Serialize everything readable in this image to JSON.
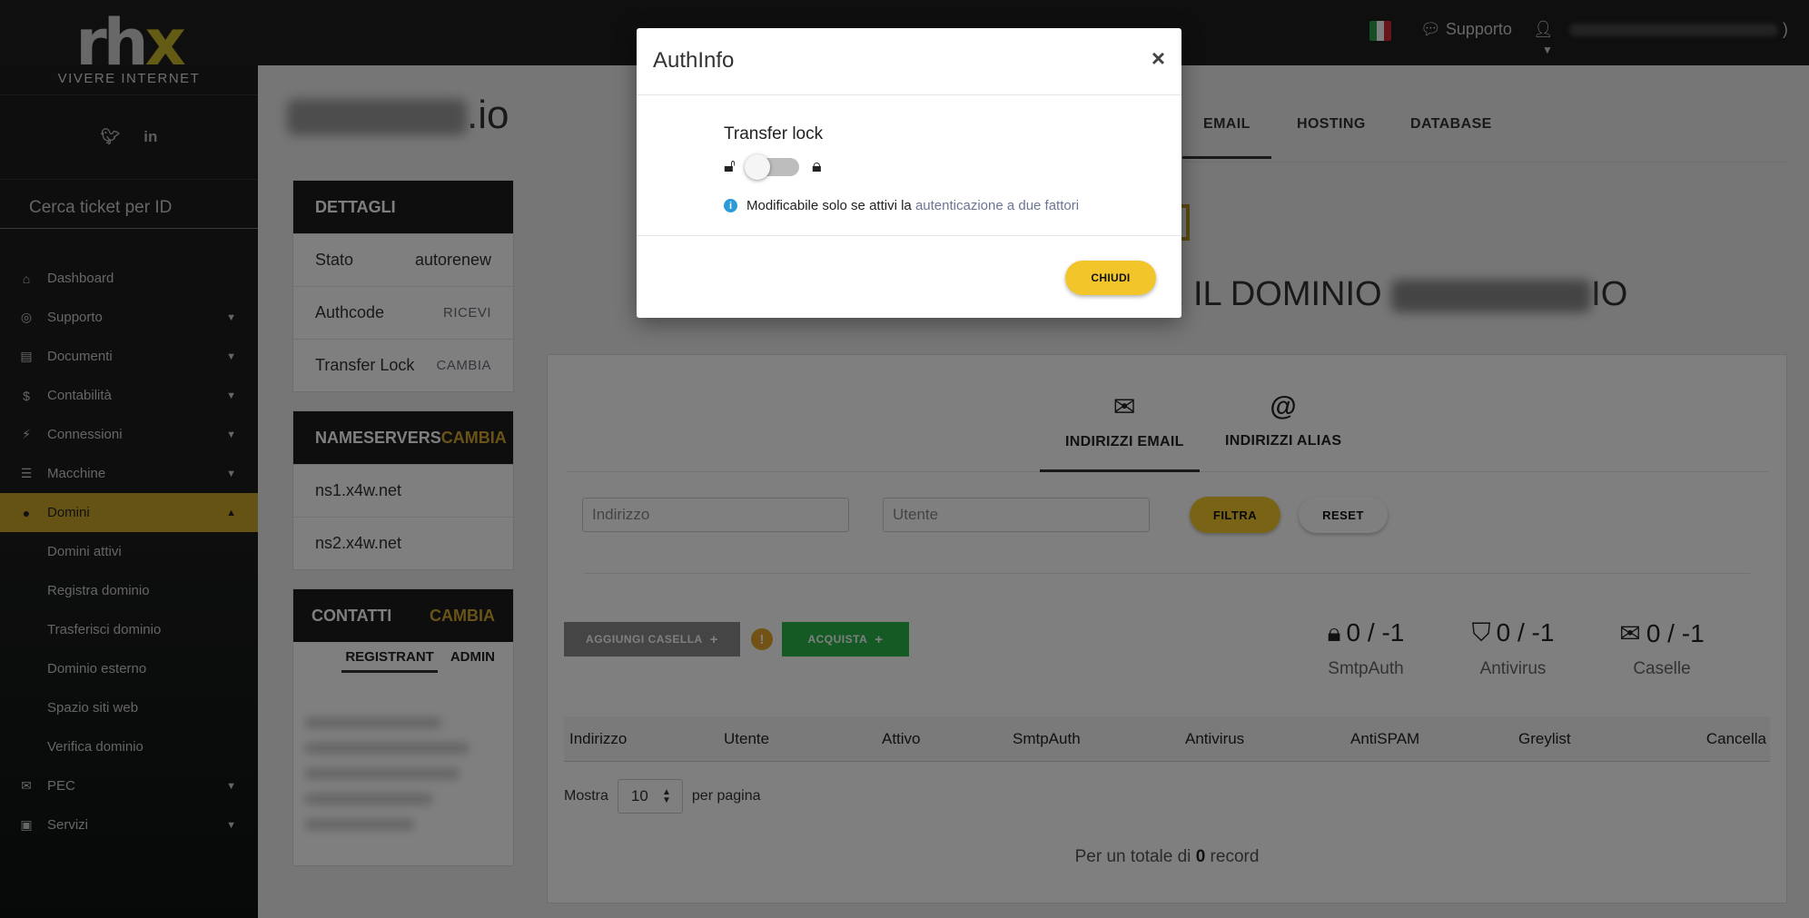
{
  "sidebar": {
    "logo_mark_a": "rh",
    "logo_mark_b": "x",
    "logo_sub": "VIVERE INTERNET",
    "ticket_search_placeholder": "Cerca ticket per ID",
    "items": [
      {
        "label": "Dashboard",
        "icon": "home-icon",
        "glyph": "⌂"
      },
      {
        "label": "Supporto",
        "icon": "support-icon",
        "glyph": "◎"
      },
      {
        "label": "Documenti",
        "icon": "file-icon",
        "glyph": "▤"
      },
      {
        "label": "Contabilità",
        "icon": "dollar-icon",
        "glyph": "$"
      },
      {
        "label": "Connessioni",
        "icon": "plug-icon",
        "glyph": "⚡"
      },
      {
        "label": "Macchine",
        "icon": "server-icon",
        "glyph": "☰"
      },
      {
        "label": "Domini",
        "icon": "globe-icon",
        "glyph": "●"
      }
    ],
    "submenu": [
      "Domini attivi",
      "Registra dominio",
      "Trasferisci dominio",
      "Dominio esterno",
      "Spazio siti web",
      "Verifica dominio"
    ],
    "items_after": [
      {
        "label": "PEC",
        "icon": "envelope-open-icon",
        "glyph": "✉"
      },
      {
        "label": "Servizi",
        "icon": "bag-icon",
        "glyph": "▣"
      }
    ]
  },
  "topbar": {
    "support_label": "Supporto",
    "user_suffix": ")",
    "flag_colors": [
      "#2e9a48",
      "#ffffff",
      "#ce2b37"
    ]
  },
  "domain": {
    "tld": ".io"
  },
  "details": {
    "title": "DETTAGLI",
    "rows": [
      {
        "label": "Stato",
        "value": "autorenew"
      },
      {
        "label": "Authcode",
        "action": "RICEVI"
      },
      {
        "label": "Transfer Lock",
        "action": "CAMBIA"
      }
    ]
  },
  "nameservers": {
    "title": "NAMESERVERS",
    "action": "CAMBIA",
    "items": [
      "ns1.x4w.net",
      "ns2.x4w.net"
    ]
  },
  "contacts": {
    "title": "CONTATTI",
    "action": "CAMBIA",
    "tabs": [
      "REGISTRANT",
      "ADMIN"
    ]
  },
  "main_tabs": [
    "EMAIL",
    "HOSTING",
    "DATABASE"
  ],
  "heading": {
    "text": "R IL DOMINIO",
    "suffix": "IO"
  },
  "email_panel": {
    "subtabs": [
      "INDIRIZZI EMAIL",
      "INDIRIZZI ALIAS"
    ],
    "filter_address_placeholder": "Indirizzo",
    "filter_user_placeholder": "Utente",
    "filter_button": "FILTRA",
    "reset_button": "RESET",
    "add_button": "AGGIUNGI CASELLA",
    "buy_button": "ACQUISTA",
    "counters": [
      {
        "value": "0 / -1",
        "label": "SmtpAuth",
        "icon": "lock-icon"
      },
      {
        "value": "0 / -1",
        "label": "Antivirus",
        "icon": "shield-icon"
      },
      {
        "value": "0 / -1",
        "label": "Caselle",
        "icon": "envelope-icon"
      }
    ],
    "columns": [
      "Indirizzo",
      "Utente",
      "Attivo",
      "SmtpAuth",
      "Antivirus",
      "AntiSPAM",
      "Greylist",
      "Cancella"
    ],
    "show_label": "Mostra",
    "per_page_value": "10",
    "per_page_label": "per pagina",
    "total_prefix": "Per un totale di",
    "total_count": "0",
    "total_suffix": "record"
  },
  "modal": {
    "title": "AuthInfo",
    "close_glyph": "×",
    "transfer_lock_label": "Transfer lock",
    "info_text": "Modificabile solo se attivi la",
    "info_link": "autenticazione a due fattori",
    "close_button": "CHIUDI"
  }
}
